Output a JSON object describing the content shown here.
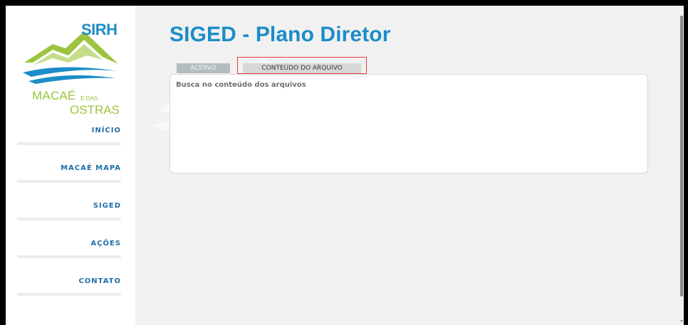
{
  "logo": {
    "top_text": "SIRH",
    "line1": "MACAÉ",
    "small": "E DAS",
    "line2": "OSTRAS",
    "colors": {
      "blue": "#1b8dc8",
      "green": "#9cc43e"
    }
  },
  "nav": {
    "items": [
      {
        "label": "INÍCIO"
      },
      {
        "label": "MACAÉ MAPA"
      },
      {
        "label": "SIGED"
      },
      {
        "label": "AÇÕES"
      },
      {
        "label": "CONTATO"
      }
    ]
  },
  "page": {
    "title": "SIGED - Plano Diretor"
  },
  "tabs": [
    {
      "label": "ACERVO",
      "active": false
    },
    {
      "label": "CONTEÚDO DO ARQUIVO",
      "active": true
    }
  ],
  "panel": {
    "label": "Busca no conteúdo dos arquivos"
  },
  "colors": {
    "accent": "#1b8dc8",
    "nav_text": "#1f6fa8",
    "highlight_outline": "#e0403c"
  }
}
